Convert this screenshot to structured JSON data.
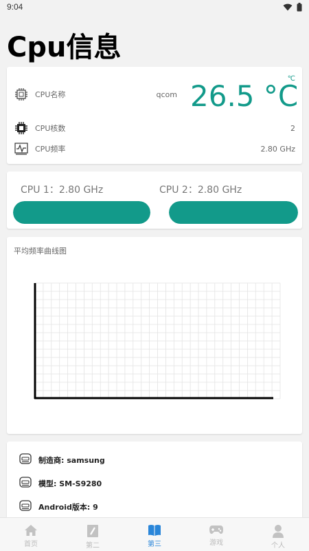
{
  "status_bar": {
    "time": "9:04"
  },
  "page": {
    "title": "Cpu信息"
  },
  "cpu_card": {
    "temperature": "26.5 °C",
    "temperature_unit": "℃",
    "rows": [
      {
        "label": "CPU名称",
        "value": "qcom"
      },
      {
        "label": "CPU核数",
        "value": "2"
      },
      {
        "label": "CPU频率",
        "value": "2.80 GHz"
      }
    ]
  },
  "cores": [
    {
      "label": "CPU 1：2.80 GHz",
      "load": 1.0
    },
    {
      "label": "CPU 2：2.80 GHz",
      "load": 1.0
    }
  ],
  "chart": {
    "title": "平均频率曲线图"
  },
  "chart_data": {
    "type": "line",
    "title": "平均频率曲线图",
    "series": [],
    "grid": true
  },
  "device": {
    "rows": [
      {
        "text": "制造商: samsung"
      },
      {
        "text": "模型: SM-S9280"
      },
      {
        "text": "Android版本: 9"
      }
    ]
  },
  "nav": {
    "tabs": [
      {
        "label": "首页",
        "icon": "home-icon"
      },
      {
        "label": "第二",
        "icon": "edit-icon"
      },
      {
        "label": "第三",
        "icon": "book-icon",
        "active": true
      },
      {
        "label": "游戏",
        "icon": "gamepad-icon"
      },
      {
        "label": "个人",
        "icon": "person-icon"
      }
    ]
  },
  "colors": {
    "accent": "#129a8a",
    "nav_active": "#2a86d9",
    "nav_inactive": "#bbbbbb"
  }
}
